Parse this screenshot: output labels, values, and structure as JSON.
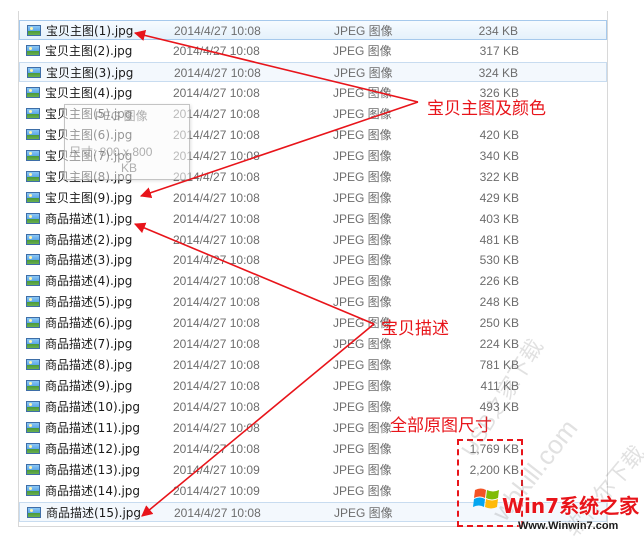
{
  "files": [
    {
      "name": "宝贝主图(1).jpg",
      "date": "2014/4/27 10:08",
      "type": "JPEG 图像",
      "size": "234 KB",
      "state": "selected"
    },
    {
      "name": "宝贝主图(2).jpg",
      "date": "2014/4/27 10:08",
      "type": "JPEG 图像",
      "size": "317 KB",
      "state": ""
    },
    {
      "name": "宝贝主图(3).jpg",
      "date": "2014/4/27 10:08",
      "type": "JPEG 图像",
      "size": "324 KB",
      "state": "hover"
    },
    {
      "name": "宝贝主图(4).jpg",
      "date": "2014/4/27 10:08",
      "type": "JPEG 图像",
      "size": "326 KB",
      "state": ""
    },
    {
      "name": "宝贝主图(5).jpg",
      "date": "2014/4/27 10:08",
      "type": "JPEG 图像",
      "size": "",
      "state": ""
    },
    {
      "name": "宝贝主图(6).jpg",
      "date": "2014/4/27 10:08",
      "type": "JPEG 图像",
      "size": "420 KB",
      "state": ""
    },
    {
      "name": "宝贝主图(7).jpg",
      "date": "2014/4/27 10:08",
      "type": "JPEG 图像",
      "size": "340 KB",
      "state": ""
    },
    {
      "name": "宝贝主图(8).jpg",
      "date": "2014/4/27 10:08",
      "type": "JPEG 图像",
      "size": "322 KB",
      "state": ""
    },
    {
      "name": "宝贝主图(9).jpg",
      "date": "2014/4/27 10:08",
      "type": "JPEG 图像",
      "size": "429 KB",
      "state": ""
    },
    {
      "name": "商品描述(1).jpg",
      "date": "2014/4/27 10:08",
      "type": "JPEG 图像",
      "size": "403 KB",
      "state": ""
    },
    {
      "name": "商品描述(2).jpg",
      "date": "2014/4/27 10:08",
      "type": "JPEG 图像",
      "size": "481 KB",
      "state": ""
    },
    {
      "name": "商品描述(3).jpg",
      "date": "2014/4/27 10:08",
      "type": "JPEG 图像",
      "size": "530 KB",
      "state": ""
    },
    {
      "name": "商品描述(4).jpg",
      "date": "2014/4/27 10:08",
      "type": "JPEG 图像",
      "size": "226 KB",
      "state": ""
    },
    {
      "name": "商品描述(5).jpg",
      "date": "2014/4/27 10:08",
      "type": "JPEG 图像",
      "size": "248 KB",
      "state": ""
    },
    {
      "name": "商品描述(6).jpg",
      "date": "2014/4/27 10:08",
      "type": "JPEG 图像",
      "size": "250 KB",
      "state": ""
    },
    {
      "name": "商品描述(7).jpg",
      "date": "2014/4/27 10:08",
      "type": "JPEG 图像",
      "size": "224 KB",
      "state": ""
    },
    {
      "name": "商品描述(8).jpg",
      "date": "2014/4/27 10:08",
      "type": "JPEG 图像",
      "size": "781 KB",
      "state": ""
    },
    {
      "name": "商品描述(9).jpg",
      "date": "2014/4/27 10:08",
      "type": "JPEG 图像",
      "size": "411 KB",
      "state": ""
    },
    {
      "name": "商品描述(10).jpg",
      "date": "2014/4/27 10:08",
      "type": "JPEG 图像",
      "size": "493 KB",
      "state": ""
    },
    {
      "name": "商品描述(11).jpg",
      "date": "2014/4/27 10:08",
      "type": "JPEG 图像",
      "size": "",
      "state": ""
    },
    {
      "name": "商品描述(12).jpg",
      "date": "2014/4/27 10:08",
      "type": "JPEG 图像",
      "size": "1,769 KB",
      "state": ""
    },
    {
      "name": "商品描述(13).jpg",
      "date": "2014/4/27 10:09",
      "type": "JPEG 图像",
      "size": "2,200 KB",
      "state": ""
    },
    {
      "name": "商品描述(14).jpg",
      "date": "2014/4/27 10:09",
      "type": "JPEG 图像",
      "size": "",
      "state": ""
    },
    {
      "name": "商品描述(15).jpg",
      "date": "2014/4/27 10:08",
      "type": "JPEG 图像",
      "size": "",
      "state": "hover"
    }
  ],
  "tooltip": {
    "line1": "PEG 图像",
    "line2": "尺寸: 800 x 800",
    "line3": "KB"
  },
  "annotations": {
    "main_images": "宝贝主图及颜色",
    "description": "宝贝描述",
    "original_size": "全部原图尺寸"
  },
  "watermarks": {
    "w1": "USB之家下载",
    "w2": "wbkill.com",
    "w3": "软件尔下载"
  },
  "logo": {
    "text": "Win7系统之家",
    "url": "Www.Winwin7.com"
  },
  "colors": {
    "annotation_red": "#e8141a",
    "selection_border": "#a6c9ec",
    "secondary_text": "#6d6d6d"
  }
}
